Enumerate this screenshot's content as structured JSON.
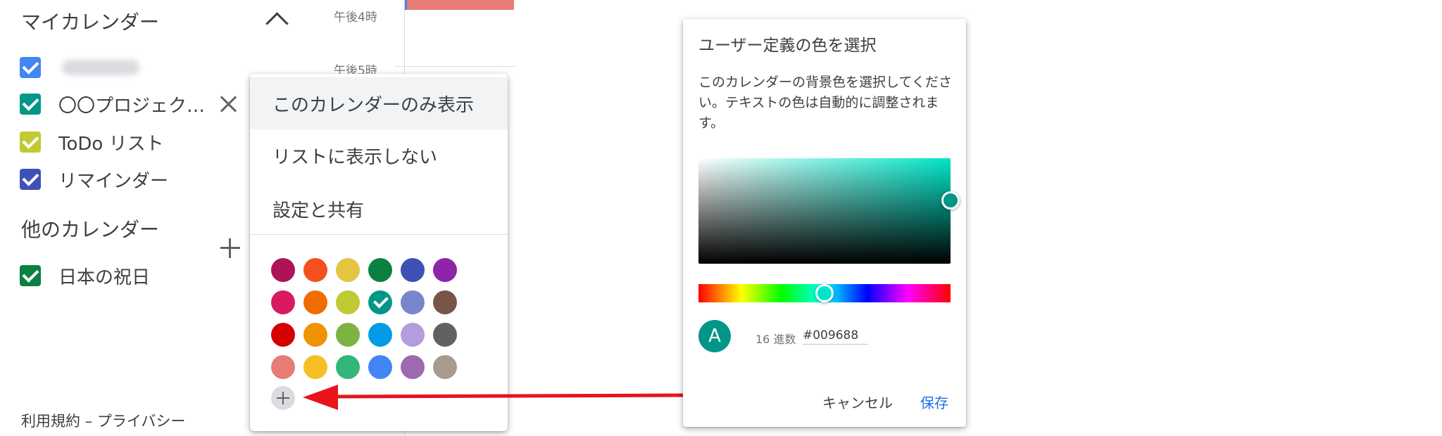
{
  "sidebar": {
    "my_calendars_title": "マイカレンダー",
    "my_calendars": [
      {
        "label": "",
        "color": "#4285f4",
        "blurred": true
      },
      {
        "label": "〇〇プロジェク…",
        "color": "#009688"
      },
      {
        "label": "ToDo リスト",
        "color": "#c0ca33"
      },
      {
        "label": "リマインダー",
        "color": "#3f51b5"
      }
    ],
    "other_calendars_title": "他のカレンダー",
    "other_calendars": [
      {
        "label": "日本の祝日",
        "color": "#0b8043"
      }
    ],
    "footer": "利用規約 – プライバシー"
  },
  "timeline": {
    "times": [
      "午後4時",
      "午後5時"
    ],
    "event_color": "#e67c73"
  },
  "menu": {
    "items": [
      "このカレンダーのみ表示",
      "リストに表示しない",
      "設定と共有"
    ],
    "swatches": [
      [
        "#ad1457",
        "#f4511e",
        "#e4c441",
        "#0b8043",
        "#3f51b5",
        "#8e24aa"
      ],
      [
        "#d81b60",
        "#ef6c00",
        "#c0ca33",
        "#009688",
        "#7986cb",
        "#795548"
      ],
      [
        "#d50000",
        "#f09300",
        "#7cb342",
        "#039be5",
        "#b39ddb",
        "#616161"
      ],
      [
        "#e67c73",
        "#f6bf26",
        "#33b679",
        "#4285f4",
        "#9e69af",
        "#a79b8e"
      ]
    ],
    "selected_color": "#009688"
  },
  "dialog": {
    "title": "ユーザー定義の色を選択",
    "description": "このカレンダーの背景色を選択してください。テキストの色は自動的に調整されます。",
    "avatar_letter": "A",
    "hex_label": "16 進数",
    "hex_value": "#009688",
    "cancel_label": "キャンセル",
    "save_label": "保存",
    "accent_color": "#1a73e8",
    "hue_position": 0.5,
    "saturation_position": 1.0
  },
  "annotation": {
    "arrow_color": "#e8141a"
  }
}
